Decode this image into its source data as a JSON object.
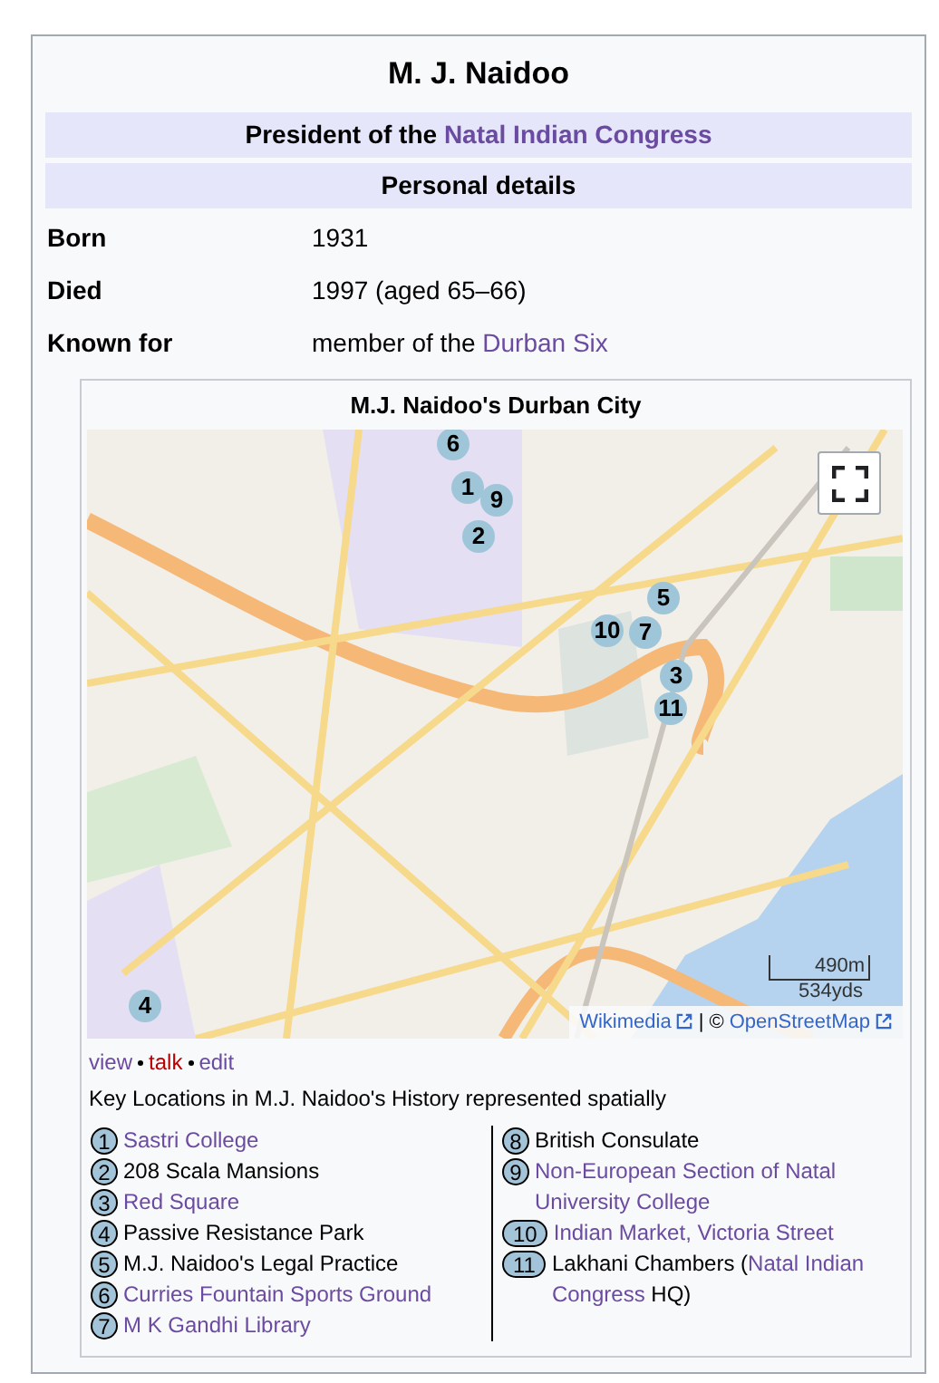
{
  "title": "M. J. Naidoo",
  "office": {
    "prefix": "President of the ",
    "link": "Natal Indian Congress"
  },
  "section_header": "Personal details",
  "details": [
    {
      "label": "Born",
      "parts": [
        {
          "kind": "text",
          "text": "1931"
        }
      ]
    },
    {
      "label": "Died",
      "parts": [
        {
          "kind": "text",
          "text": "1997 (aged 65–66)"
        }
      ]
    },
    {
      "label": "Known for",
      "parts": [
        {
          "kind": "text",
          "text": "member of the "
        },
        {
          "kind": "link",
          "text": "Durban Six"
        }
      ]
    }
  ],
  "map": {
    "caption": "M.J. Naidoo's Durban City",
    "markers": [
      "6",
      "1",
      "9",
      "2",
      "5",
      "10",
      "7",
      "3",
      "11",
      "4"
    ],
    "scale": {
      "metric": "490m",
      "imperial": "534yds"
    },
    "attribution": {
      "first": "Wikimedia",
      "separator": "| ©",
      "second": "OpenStreetMap"
    }
  },
  "template_links": [
    {
      "text": "view",
      "kind": "link"
    },
    {
      "text": "talk",
      "kind": "redlink"
    },
    {
      "text": "edit",
      "kind": "link"
    }
  ],
  "legend_title": "Key Locations in M.J. Naidoo's History represented spatially",
  "legend_columns": [
    [
      {
        "number": "1",
        "parts": [
          {
            "kind": "link",
            "text": "Sastri College"
          }
        ]
      },
      {
        "number": "2",
        "parts": [
          {
            "kind": "text",
            "text": "208 Scala Mansions"
          }
        ]
      },
      {
        "number": "3",
        "parts": [
          {
            "kind": "link",
            "text": "Red Square"
          }
        ]
      },
      {
        "number": "4",
        "parts": [
          {
            "kind": "text",
            "text": "Passive Resistance Park"
          }
        ]
      },
      {
        "number": "5",
        "parts": [
          {
            "kind": "text",
            "text": "M.J. Naidoo's Legal Practice"
          }
        ]
      },
      {
        "number": "6",
        "parts": [
          {
            "kind": "link",
            "text": "Curries Fountain Sports Ground"
          }
        ]
      },
      {
        "number": "7",
        "parts": [
          {
            "kind": "link",
            "text": "M K Gandhi Library"
          }
        ]
      }
    ],
    [
      {
        "number": "8",
        "parts": [
          {
            "kind": "text",
            "text": "British Consulate"
          }
        ]
      },
      {
        "number": "9",
        "parts": [
          {
            "kind": "link",
            "text": "Non-European Section of Natal University College"
          }
        ]
      },
      {
        "number": "10",
        "parts": [
          {
            "kind": "link",
            "text": "Indian Market, Victoria Street"
          }
        ]
      },
      {
        "number": "11",
        "parts": [
          {
            "kind": "text",
            "text": "Lakhani Chambers ("
          },
          {
            "kind": "link",
            "text": "Natal Indian Congress"
          },
          {
            "kind": "text",
            "text": " HQ)"
          }
        ]
      }
    ]
  ]
}
